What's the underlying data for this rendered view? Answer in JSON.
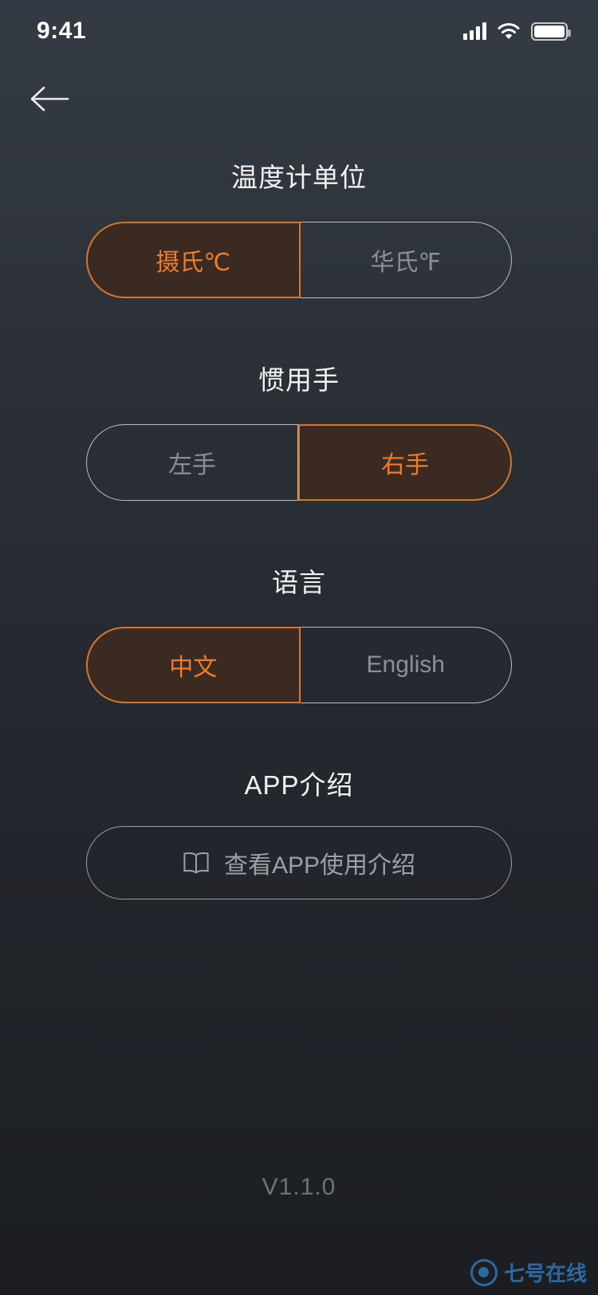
{
  "status_bar": {
    "time": "9:41",
    "icons": [
      "signal-bars-icon",
      "wifi-icon",
      "battery-icon"
    ]
  },
  "nav": {
    "back_icon": "back-arrow-icon"
  },
  "theme": {
    "accent": "#f07c26",
    "accent_border": "#d4772c",
    "selected_fill": "#3a2a22",
    "inactive_text": "#8b9097",
    "title_text": "#f0f2f4",
    "background_top": "#343a43",
    "background_bottom": "#1b1d22",
    "watermark_color": "#2e6ea6"
  },
  "sections": [
    {
      "title": "温度计单位",
      "options": [
        {
          "label": "摄氏℃",
          "selected": true
        },
        {
          "label": "华氏℉",
          "selected": false
        }
      ]
    },
    {
      "title": "惯用手",
      "options": [
        {
          "label": "左手",
          "selected": false
        },
        {
          "label": "右手",
          "selected": true
        }
      ]
    },
    {
      "title": "语言",
      "options": [
        {
          "label": "中文",
          "selected": true
        },
        {
          "label": "English",
          "selected": false
        }
      ]
    }
  ],
  "app_intro": {
    "title": "APP介绍",
    "button_label": "查看APP使用介绍",
    "button_icon": "book-icon"
  },
  "footer": {
    "version": "V1.1.0"
  },
  "watermark": {
    "text": "七号在线"
  }
}
